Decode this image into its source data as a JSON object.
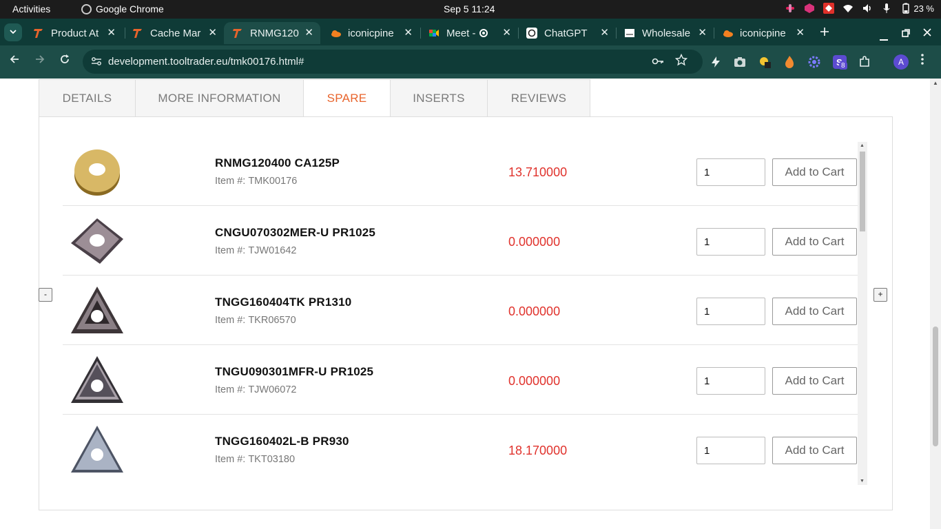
{
  "system_bar": {
    "activities": "Activities",
    "app_name": "Google Chrome",
    "clock": "Sep 5  11:24",
    "battery": "23 %"
  },
  "browser": {
    "tabs": [
      {
        "title": "Product At",
        "icon": "tooltrader-icon",
        "active": false
      },
      {
        "title": "Cache Mar",
        "icon": "tooltrader-icon",
        "active": false
      },
      {
        "title": "RNMG120",
        "icon": "tooltrader-icon",
        "active": true
      },
      {
        "title": "iconicpine",
        "icon": "cloud-icon",
        "active": false
      },
      {
        "title": "Meet - r",
        "icon": "meet-icon",
        "active": false
      },
      {
        "title": "ChatGPT",
        "icon": "chatgpt-icon",
        "active": false
      },
      {
        "title": "Wholesale",
        "icon": "doc-icon",
        "active": false
      },
      {
        "title": "iconicpine",
        "icon": "cloud-icon",
        "active": false
      }
    ],
    "url": "development.tooltrader.eu/tmk00176.html#",
    "profile_initial": "A",
    "extension_badge": "8"
  },
  "page": {
    "tabs": [
      {
        "label": "DETAILS",
        "active": false
      },
      {
        "label": "MORE INFORMATION",
        "active": false
      },
      {
        "label": "SPARE",
        "active": true
      },
      {
        "label": "INSERTS",
        "active": false
      },
      {
        "label": "REVIEWS",
        "active": false
      }
    ],
    "item_prefix": "Item #:",
    "add_to_cart_label": "Add to Cart",
    "prev_label": "-",
    "next_label": "+",
    "accent_color": "#e8642c",
    "price_color": "#e0322c",
    "products": [
      {
        "name": "RNMG120400 CA125P",
        "item_no": "TMK00176",
        "price": "13.710000",
        "qty": "1",
        "image": "round-gold-insert"
      },
      {
        "name": "CNGU070302MER-U PR1025",
        "item_no": "TJW01642",
        "price": "0.000000",
        "qty": "1",
        "image": "rhombic-insert"
      },
      {
        "name": "TNGG160404TK PR1310",
        "item_no": "TKR06570",
        "price": "0.000000",
        "qty": "1",
        "image": "triangular-insert"
      },
      {
        "name": "TNGU090301MFR-U PR1025",
        "item_no": "TJW06072",
        "price": "0.000000",
        "qty": "1",
        "image": "triangular-insert"
      },
      {
        "name": "TNGG160402L-B PR930",
        "item_no": "TKT03180",
        "price": "18.170000",
        "qty": "1",
        "image": "triangular-insert-silver"
      }
    ]
  }
}
